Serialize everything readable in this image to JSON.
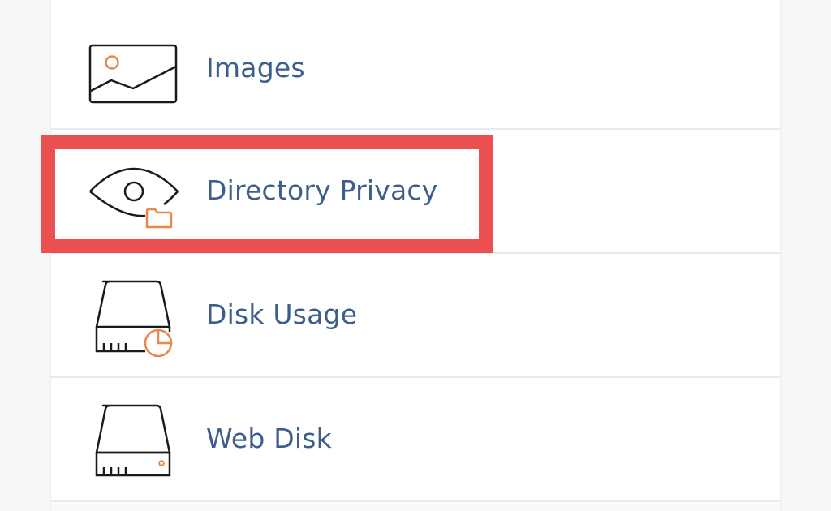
{
  "tools": [
    {
      "label": "Images",
      "icon": "image-icon"
    },
    {
      "label": "Directory Privacy",
      "icon": "eye-folder-icon"
    },
    {
      "label": "Disk Usage",
      "icon": "disk-usage-icon"
    },
    {
      "label": "Web Disk",
      "icon": "web-disk-icon"
    }
  ],
  "colors": {
    "label": "#3d5e8c",
    "accent": "#e8884a",
    "highlight": "#e9504f",
    "stroke": "#1a1a1a"
  }
}
